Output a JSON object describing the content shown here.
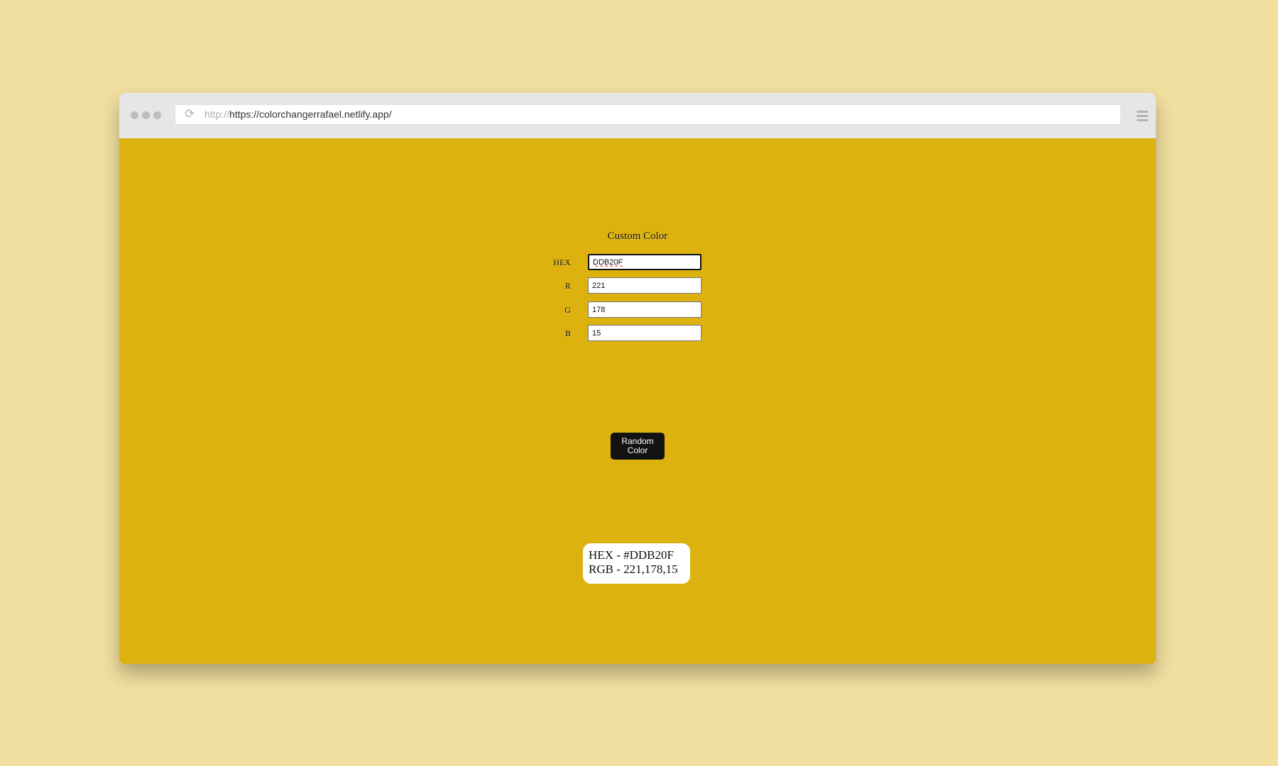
{
  "browser": {
    "url_protocol": "http://",
    "url": "https://colorchangerrafael.netlify.app/",
    "reload_icon": "reload-icon",
    "menu_icon": "hamburger-menu-icon"
  },
  "page": {
    "background_color": "#DDB20F",
    "form": {
      "title": "Custom Color",
      "fields": [
        {
          "label": "HEX",
          "value": "DDB20F"
        },
        {
          "label": "R",
          "value": "221"
        },
        {
          "label": "G",
          "value": "178"
        },
        {
          "label": "B",
          "value": "15"
        }
      ]
    },
    "random_button": {
      "line1": "Random",
      "line2": "Color"
    },
    "readout": {
      "hex_line": "HEX - #DDB20F",
      "rgb_line": "RGB - 221,178,15"
    }
  }
}
